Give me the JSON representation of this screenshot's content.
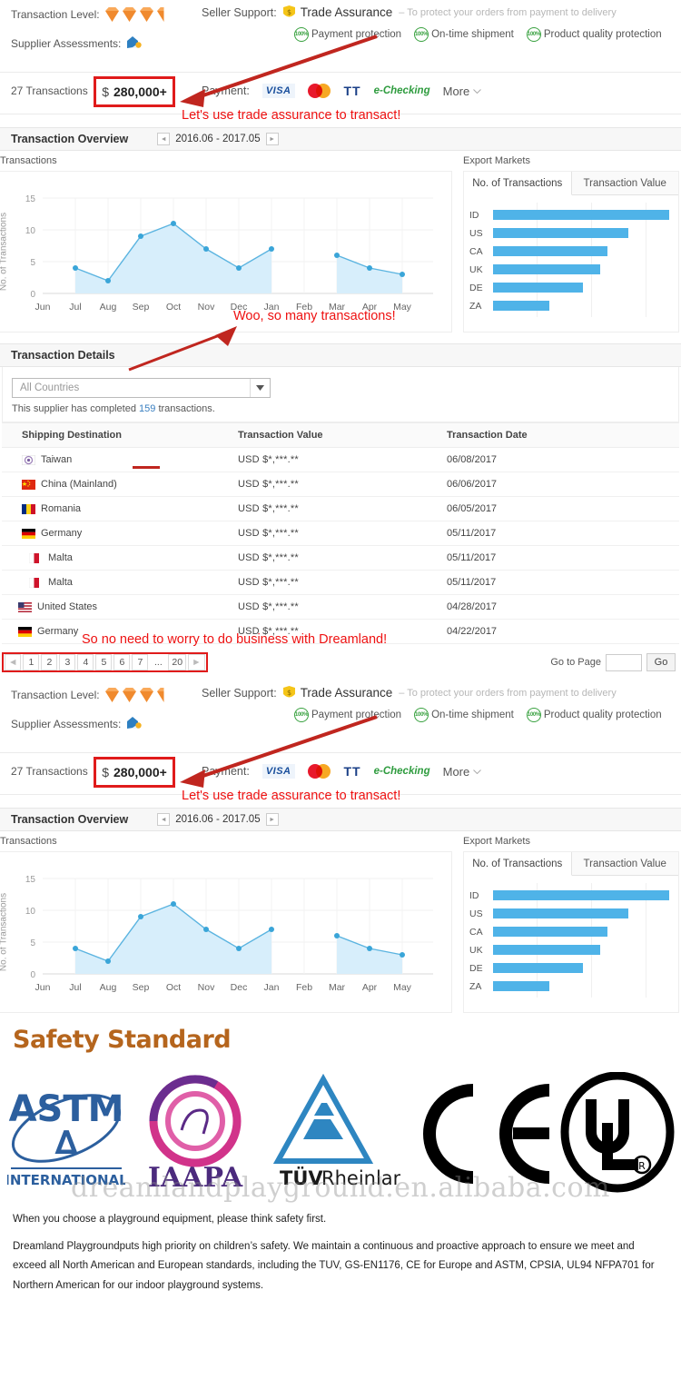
{
  "supplier": {
    "transaction_level_label": "Transaction Level:",
    "diamonds_full": 3,
    "diamonds_half": 1,
    "assessments_label": "Supplier Assessments:",
    "seller_support_label": "Seller Support:",
    "trade_assurance": "Trade Assurance",
    "trade_assurance_desc": "– To protect your orders from payment to delivery",
    "protections": [
      {
        "pct": "100%",
        "text": "Payment protection"
      },
      {
        "pct": "100%",
        "text": "On-time shipment"
      },
      {
        "pct": "100%",
        "text": "Product quality protection"
      }
    ],
    "transactions_count": "27 Transactions",
    "dollar_sign": "$",
    "amount": "280,000+",
    "payment_label": "Payment:",
    "payment_methods": [
      "VISA",
      "TT",
      "e-Checking"
    ],
    "more_label": "More"
  },
  "overview": {
    "title": "Transaction Overview",
    "range": "2016.06 - 2017.05",
    "prev_icon": "◄",
    "next_icon": "►"
  },
  "chart_data": [
    {
      "type": "area",
      "title": "Transactions",
      "ylabel": "No. of Transactions",
      "xlabel": "",
      "categories": [
        "Jun",
        "Jul",
        "Aug",
        "Sep",
        "Oct",
        "Nov",
        "Dec",
        "Jan",
        "Feb",
        "Mar",
        "Apr",
        "May"
      ],
      "values": [
        null,
        4,
        2,
        9,
        11,
        7,
        4,
        7,
        null,
        6,
        4,
        3
      ],
      "ylim": [
        0,
        15
      ],
      "yticks": [
        0,
        5,
        10,
        15
      ],
      "grid": true,
      "legend": "none",
      "line_color": "#4fb3e8",
      "area_color": "#d7eefb"
    },
    {
      "type": "bar",
      "orientation": "horizontal",
      "title": "Export Markets",
      "tabs": [
        "No. of Transactions",
        "Transaction Value"
      ],
      "active_tab": "No. of Transactions",
      "categories": [
        "ID",
        "US",
        "CA",
        "UK",
        "DE",
        "ZA"
      ],
      "values": [
        100,
        77,
        65,
        61,
        51,
        32
      ],
      "ylim": [
        0,
        100
      ],
      "grid": true,
      "bar_color": "#4fb3e8"
    }
  ],
  "details": {
    "title": "Transaction Details",
    "country_filter_value": "All Countries",
    "completed_prefix": "This supplier has completed",
    "completed_count": "159",
    "completed_suffix": "transactions.",
    "columns": [
      "Shipping Destination",
      "Transaction Value",
      "Transaction Date"
    ],
    "rows": [
      {
        "country": "Taiwan",
        "flag": "tw",
        "value": "USD $*,***.**",
        "date": "06/08/2017"
      },
      {
        "country": "China (Mainland)",
        "flag": "cn",
        "value": "USD $*,***.**",
        "date": "06/06/2017"
      },
      {
        "country": "Romania",
        "flag": "ro",
        "value": "USD $*,***.**",
        "date": "06/05/2017"
      },
      {
        "country": "Germany",
        "flag": "de",
        "value": "USD $*,***.**",
        "date": "05/11/2017"
      },
      {
        "country": "Malta",
        "flag": "mt",
        "value": "USD $*,***.**",
        "date": "05/11/2017"
      },
      {
        "country": "Malta",
        "flag": "mt",
        "value": "USD $*,***.**",
        "date": "05/11/2017"
      },
      {
        "country": "United States",
        "flag": "us",
        "value": "USD $*,***.**",
        "date": "04/28/2017"
      },
      {
        "country": "Germany",
        "flag": "de",
        "value": "USD $*,***.**",
        "date": "04/22/2017"
      }
    ],
    "pagination": {
      "prev": "◄",
      "pages": [
        "1",
        "2",
        "3",
        "4",
        "5",
        "6",
        "7"
      ],
      "ellipsis": "...",
      "last": "20",
      "next": "►"
    },
    "goto_label": "Go to Page",
    "goto_value": "",
    "go_button": "Go"
  },
  "annotations": [
    {
      "id": "a1",
      "text": "Let's use trade assurance to transact!"
    },
    {
      "id": "a2",
      "text": "Woo, so many transactions!"
    },
    {
      "id": "a3",
      "text": "So no need to worry to do business with Dreamland!"
    },
    {
      "id": "a4",
      "text": "Let's use trade assurance to transact!"
    }
  ],
  "safety": {
    "heading": "Safety Standard",
    "logos": [
      "ASTM INTERNATIONAL",
      "IAAPA",
      "TÜVRheinland",
      "CE",
      "UL"
    ],
    "astm_sub": "INTERNATIONAL",
    "iaapa_text": "IAAPA",
    "tuv_text_bold": "TÜV",
    "tuv_text_rest": "Rheinland",
    "watermark": "dreamlandplayground.en.alibaba.com",
    "paragraphs": [
      "When you choose a playground equipment, please think safety first.",
      "Dreamland Playgroundputs high priority on children’s safety. We maintain a continuous and proactive approach to ensure we meet and exceed all North American and European standards, including the TUV, GS-EN1176, CE for Europe and ASTM, CPSIA, UL94 NFPA701 for Northern American for our indoor playground systems."
    ]
  }
}
